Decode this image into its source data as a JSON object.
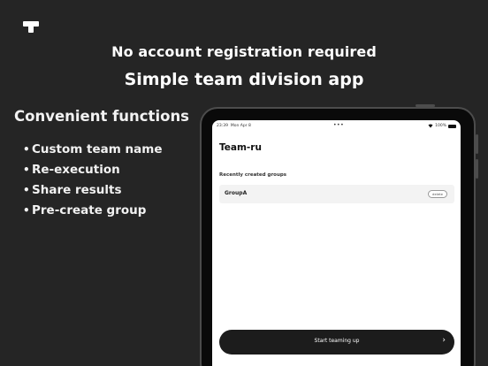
{
  "headline": {
    "line1": "No account registration required",
    "line2": "Simple team division app"
  },
  "features": {
    "title": "Convenient functions",
    "bullet": "•",
    "items": [
      "Custom team name",
      "Re-execution",
      "Share results",
      "Pre-create group"
    ]
  },
  "device": {
    "status": {
      "time": "23:39",
      "date": "Mon Apr 8",
      "dots": "•••",
      "wifi_icon": "wifi-icon",
      "battery": "100%"
    },
    "app_title": "Team-ru",
    "recent_label": "Recently created groups",
    "groups": [
      {
        "name": "GroupA",
        "action": "delete"
      }
    ],
    "start_button": "Start teaming up",
    "start_chevron": "›"
  },
  "colors": {
    "background": "#252525",
    "screen": "#ffffff",
    "button": "#1c1c1c"
  }
}
